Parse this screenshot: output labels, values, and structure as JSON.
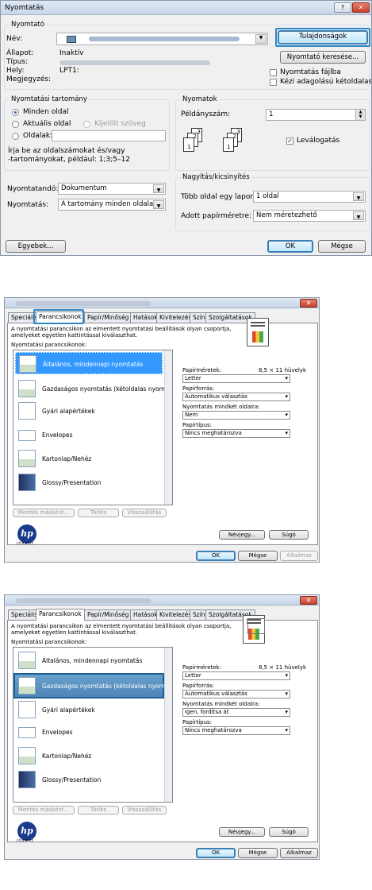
{
  "d1": {
    "title": "Nyomtatás",
    "help": "?",
    "close": "✕",
    "printer_group": "Nyomtató",
    "name_label": "Név:",
    "props_btn": "Tulajdonságok",
    "status_label": "Állapot:",
    "status_val": "Inaktív",
    "type_label": "Típus:",
    "where_label": "Hely:",
    "where_val": "LPT1:",
    "comment_label": "Megjegyzés:",
    "find_btn": "Nyomtató keresése...",
    "print_to_file": "Nyomtatás fájlba",
    "manual_duplex": "Kézi adagolású kétoldalas",
    "range_group": "Nyomtatási tartomány",
    "r_all": "Minden oldal",
    "r_current": "Aktuális oldal",
    "r_selection": "Kijelölt szöveg",
    "r_pages": "Oldalak:",
    "range_hint1": "Írja be az oldalszámokat és/vagy",
    "range_hint2": "-tartományokat, például: 1;3;5–12",
    "copies_group": "Nyomatok",
    "copies_label": "Példányszám:",
    "copies_val": "1",
    "collate": "Leválogatás",
    "what_label": "Nyomtatandó:",
    "what_val": "Dokumentum",
    "print_label": "Nyomtatás:",
    "print_val": "A tartomány minden oldala",
    "zoom_group": "Nagyítás/kicsinyítés",
    "pps_label": "Több oldal egy lapon:",
    "pps_val": "1 oldal",
    "scale_label": "Adott papírméretre:",
    "scale_val": "Nem méretezhető",
    "options_btn": "Egyebek...",
    "ok_btn": "OK",
    "cancel_btn": "Mégse"
  },
  "d2": {
    "tabs": [
      "Speciális",
      "Parancsikonok",
      "Papír/Minőség",
      "Hatások",
      "Kivitelezés",
      "Szín",
      "Szolgáltatások"
    ],
    "desc1": "A nyomtatási parancsikon az elmentett nyomtatási beállítások olyan csoportja,",
    "desc2": "amelyeket egyetlen kattintással kiválaszthat.",
    "list_label": "Nyomtatási parancsikonok:",
    "items": [
      "Általános, mindennapi nyomtatás",
      "Gazdaságos nyomtatás (kétoldalas nyomtatás)",
      "Gyári alapértékek",
      "Envelopes",
      "Kartonlap/Nehéz",
      "Glossy/Presentation"
    ],
    "paper_size_label": "Papírméretek:",
    "paper_size_val": "8,5 × 11 hüvelyk",
    "paper_size_sel": "Letter",
    "source_label": "Papírforrás:",
    "source_val": "Automatikus választás",
    "duplex_label": "Nyomtatás mindkét oldalra:",
    "type_label": "Papírtípus:",
    "type_val": "Nincs meghatározva",
    "save_btn": "Mentés másként...",
    "delete_btn": "Törlés",
    "reset_btn": "Visszaállítás",
    "about_btn": "Névjegy...",
    "help_btn": "Súgó",
    "ok_btn": "OK",
    "cancel_btn": "Mégse",
    "apply_btn": "Alkalmaz",
    "close": "✕",
    "hp": "hp",
    "invent": "invent"
  },
  "d2a": {
    "duplex_val": "Nem"
  },
  "d2b": {
    "duplex_val": "Igen, fordítsa át"
  }
}
